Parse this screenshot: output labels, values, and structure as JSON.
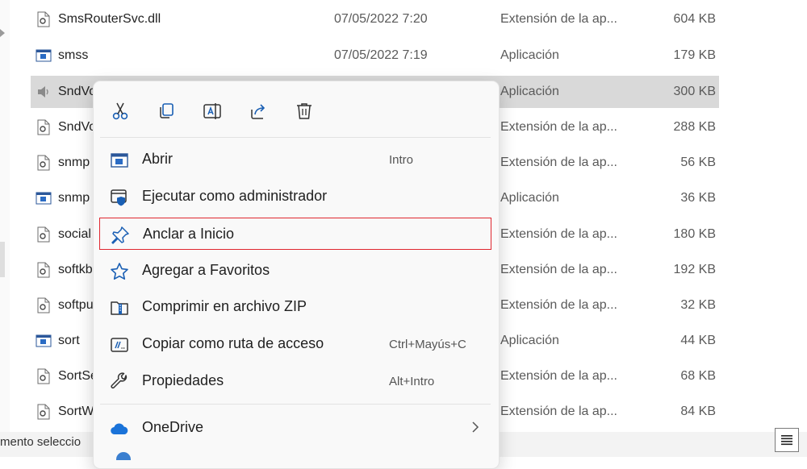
{
  "file_list": {
    "rows": [
      {
        "name": "SmsRouterSvc.dll",
        "date": "07/05/2022 7:20",
        "type": "Extensión de la ap...",
        "size": "604 KB",
        "icon": "dll-file-icon"
      },
      {
        "name": "smss",
        "date": "07/05/2022 7:19",
        "type": "Aplicación",
        "size": "179 KB",
        "icon": "app-window-icon"
      },
      {
        "name": "SndVo",
        "date": "",
        "type": "Aplicación",
        "size": "300 KB",
        "icon": "speaker-icon"
      },
      {
        "name": "SndVo",
        "date": "",
        "type": "Extensión de la ap...",
        "size": "288 KB",
        "icon": "dll-file-icon"
      },
      {
        "name": "snmp",
        "date": "",
        "type": "Extensión de la ap...",
        "size": "56 KB",
        "icon": "dll-file-icon"
      },
      {
        "name": "snmp",
        "date": "",
        "type": "Aplicación",
        "size": "36 KB",
        "icon": "app-window-icon"
      },
      {
        "name": "social",
        "date": "",
        "type": "Extensión de la ap...",
        "size": "180 KB",
        "icon": "dll-file-icon"
      },
      {
        "name": "softkb",
        "date": "",
        "type": "Extensión de la ap...",
        "size": "192 KB",
        "icon": "dll-file-icon"
      },
      {
        "name": "softpu",
        "date": "",
        "type": "Extensión de la ap...",
        "size": "32 KB",
        "icon": "dll-file-icon"
      },
      {
        "name": "sort",
        "date": "",
        "type": "Aplicación",
        "size": "44 KB",
        "icon": "app-window-icon"
      },
      {
        "name": "SortSe",
        "date": "",
        "type": "Extensión de la ap...",
        "size": "68 KB",
        "icon": "dll-file-icon"
      },
      {
        "name": "SortW",
        "date": "",
        "type": "Extensión de la ap...",
        "size": "84 KB",
        "icon": "dll-file-icon"
      }
    ]
  },
  "status_bar": {
    "text": "mento seleccio"
  },
  "context_menu": {
    "quick_actions": [
      {
        "name": "cut-icon"
      },
      {
        "name": "copy-icon"
      },
      {
        "name": "rename-icon"
      },
      {
        "name": "share-icon"
      },
      {
        "name": "delete-icon"
      }
    ],
    "items": [
      {
        "label": "Abrir",
        "shortcut": "Intro",
        "icon": "app-window-icon"
      },
      {
        "label": "Ejecutar como administrador",
        "shortcut": "",
        "icon": "shield-window-icon"
      },
      {
        "label": "Anclar a Inicio",
        "shortcut": "",
        "icon": "pin-icon"
      },
      {
        "label": "Agregar a Favoritos",
        "shortcut": "",
        "icon": "star-icon"
      },
      {
        "label": "Comprimir en archivo ZIP",
        "shortcut": "",
        "icon": "zip-folder-icon"
      },
      {
        "label": "Copiar como ruta de acceso",
        "shortcut": "Ctrl+Mayús+C",
        "icon": "path-copy-icon"
      },
      {
        "label": "Propiedades",
        "shortcut": "Alt+Intro",
        "icon": "wrench-icon"
      }
    ],
    "onedrive": {
      "label": "OneDrive",
      "icon": "cloud-icon"
    }
  },
  "colors": {
    "highlight_border": "#e0262f",
    "selected_row": "#d9d9d9",
    "accent": "#1a73d9"
  }
}
